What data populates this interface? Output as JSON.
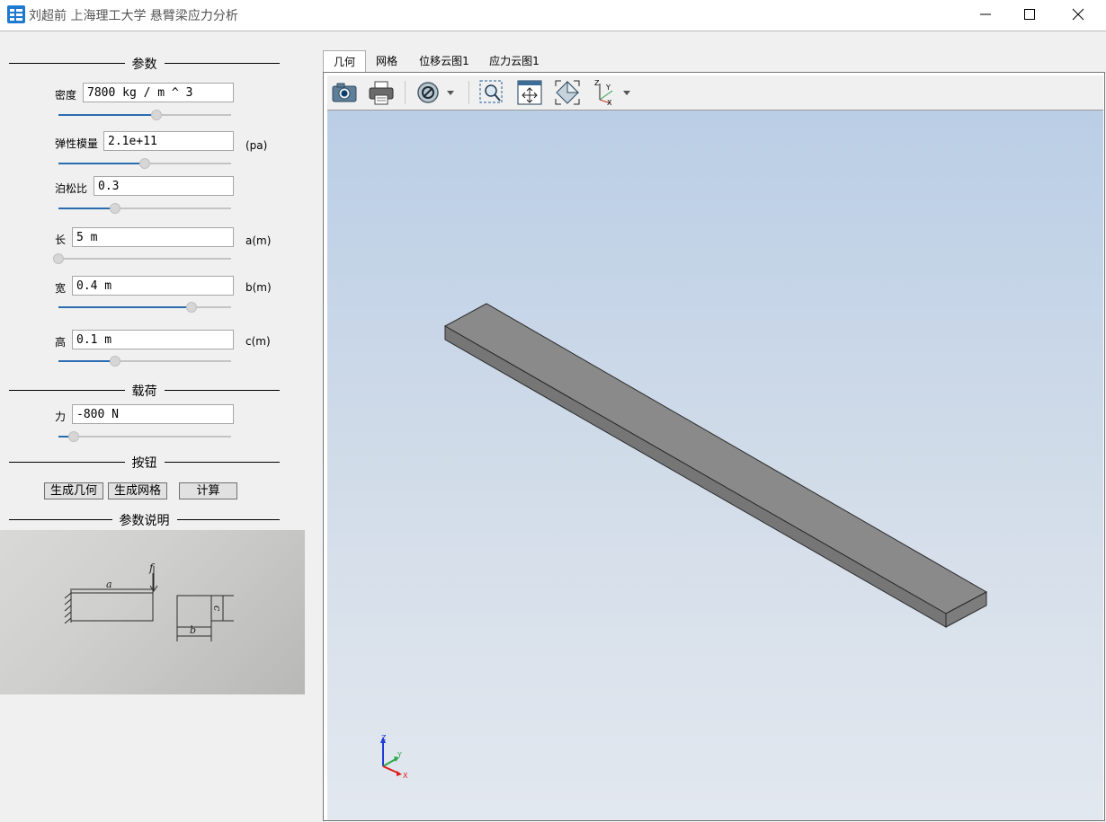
{
  "window": {
    "title": "刘超前  上海理工大学 悬臂梁应力分析"
  },
  "sections": {
    "params": "参数",
    "load": "载荷",
    "buttons": "按钮",
    "description": "参数说明"
  },
  "params": {
    "density": {
      "label": "密度",
      "value": "7800 kg / m ^ 3",
      "slider": 0.57
    },
    "elastic": {
      "label": "弹性模量",
      "value": "2.1e+11",
      "unit": "(pa)",
      "slider": 0.5
    },
    "poisson": {
      "label": "泊松比",
      "value": "0.3",
      "slider": 0.33
    },
    "length": {
      "label": "长",
      "value": "5 m",
      "unit": "a(m)",
      "slider": 0.0
    },
    "width": {
      "label": "宽",
      "value": "0.4 m",
      "unit": "b(m)",
      "slider": 0.77
    },
    "height": {
      "label": "高",
      "value": "0.1 m",
      "unit": "c(m)",
      "slider": 0.33
    }
  },
  "load": {
    "label": "力",
    "value": "-800 N",
    "slider": 0.09
  },
  "actions": {
    "gen_geometry": "生成几何",
    "gen_mesh": "生成网格",
    "compute": "计算"
  },
  "sketch_labels": {
    "force": "f",
    "a": "a",
    "b": "b",
    "c": "c"
  },
  "tabs": [
    {
      "label": "几何",
      "active": true
    },
    {
      "label": "网格",
      "active": false
    },
    {
      "label": "位移云图1",
      "active": false
    },
    {
      "label": "应力云图1",
      "active": false
    }
  ],
  "toolbar": [
    "camera-icon",
    "print-icon",
    "hide-icon",
    "zoom-box-icon",
    "fit-all-icon",
    "view-iso-icon",
    "axes-view-icon"
  ],
  "triad": {
    "x": "X",
    "y": "Y",
    "z": "Z"
  },
  "colors": {
    "slider_fill": "#2b6cb0",
    "beam_top": "#8a8a8a",
    "beam_side": "#6f6f6f",
    "viewport_top": "#bacee6",
    "viewport_bottom": "#e3e8ef"
  }
}
